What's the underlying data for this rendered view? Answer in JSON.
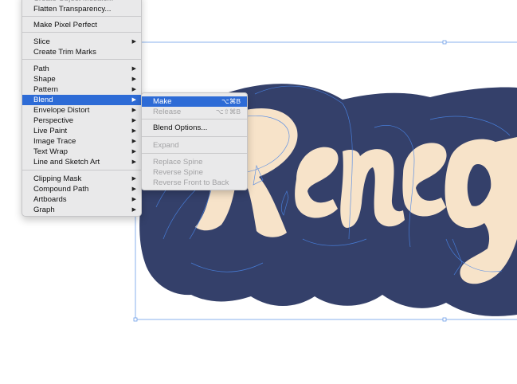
{
  "object_menu": {
    "items": [
      {
        "label": "Create Object Mosaic...",
        "submenu": false,
        "faded": true
      },
      {
        "label": "Flatten Transparency...",
        "submenu": false
      },
      {
        "label": "Make Pixel Perfect",
        "submenu": false
      },
      {
        "label": "Slice",
        "submenu": true
      },
      {
        "label": "Create Trim Marks",
        "submenu": false
      },
      {
        "label": "Path",
        "submenu": true
      },
      {
        "label": "Shape",
        "submenu": true
      },
      {
        "label": "Pattern",
        "submenu": true
      },
      {
        "label": "Blend",
        "submenu": true,
        "highlighted": true
      },
      {
        "label": "Envelope Distort",
        "submenu": true
      },
      {
        "label": "Perspective",
        "submenu": true
      },
      {
        "label": "Live Paint",
        "submenu": true
      },
      {
        "label": "Image Trace",
        "submenu": true
      },
      {
        "label": "Text Wrap",
        "submenu": true
      },
      {
        "label": "Line and Sketch Art",
        "submenu": true
      },
      {
        "label": "Clipping Mask",
        "submenu": true
      },
      {
        "label": "Compound Path",
        "submenu": true
      },
      {
        "label": "Artboards",
        "submenu": true
      },
      {
        "label": "Graph",
        "submenu": true
      }
    ]
  },
  "blend_menu": {
    "items": [
      {
        "label": "Make",
        "shortcut": "⌥⌘B",
        "highlighted": true
      },
      {
        "label": "Release",
        "shortcut": "⌥⇧⌘B",
        "disabled": true
      },
      {
        "label": "Blend Options...",
        "shortcut": ""
      },
      {
        "label": "Expand",
        "shortcut": "",
        "disabled": true
      },
      {
        "label": "Replace Spine",
        "shortcut": "",
        "disabled": true
      },
      {
        "label": "Reverse Spine",
        "shortcut": "",
        "disabled": true
      },
      {
        "label": "Reverse Front to Back",
        "shortcut": "",
        "disabled": true
      }
    ]
  },
  "artwork": {
    "text": "Reneg",
    "fill_color": "#f7e3c9",
    "shadow_color": "#34406a",
    "selection_color": "#4a86e8"
  },
  "icons": {
    "submenu_arrow": "submenu-arrow-icon"
  }
}
